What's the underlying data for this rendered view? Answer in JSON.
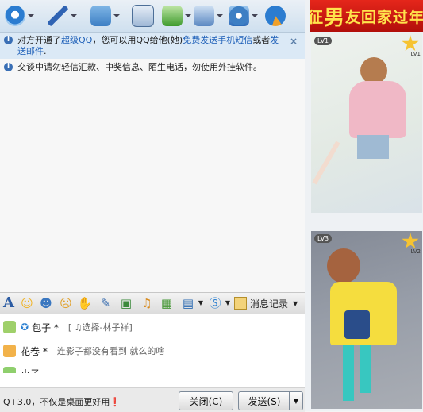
{
  "notices": [
    {
      "icon": "info-icon",
      "parts": {
        "a": "对方开通了",
        "b": "超级QQ",
        "c": "，您可以用QQ给他(她)",
        "d": "免费发送手机短信",
        "e": "或者",
        "f": "发送邮件",
        "g": "."
      }
    },
    {
      "icon": "info-icon",
      "text": "交谈中请勿轻信汇款、中奖信息、陌生电话，勿使用外挂软件。"
    }
  ],
  "toolbar": {
    "history_label": "消息记录"
  },
  "contacts": [
    {
      "name": "包子 *",
      "status": "[ ♫选择-林子祥]",
      "color": "#9fd06a"
    },
    {
      "name": "花卷 *",
      "status": "连影子都没有看到 就么的啥",
      "color": "#f2b24a"
    },
    {
      "name": "小子",
      "status": "",
      "color": "#8fcf6d"
    }
  ],
  "footer": {
    "tip": "Q+3.0，不仅是桌面更好用❗",
    "close_label": "关闭(C)",
    "send_label": "发送(S)"
  },
  "ad": {
    "title_a": "征",
    "title_big": "男",
    "title_b": "友回家过年",
    "level_1": "LV1",
    "level_1b": "LV1",
    "level_2": "LV3",
    "level_2b": "LV2"
  },
  "colors": {
    "accent": "#1d5fb8",
    "banner": "#d4201a"
  }
}
